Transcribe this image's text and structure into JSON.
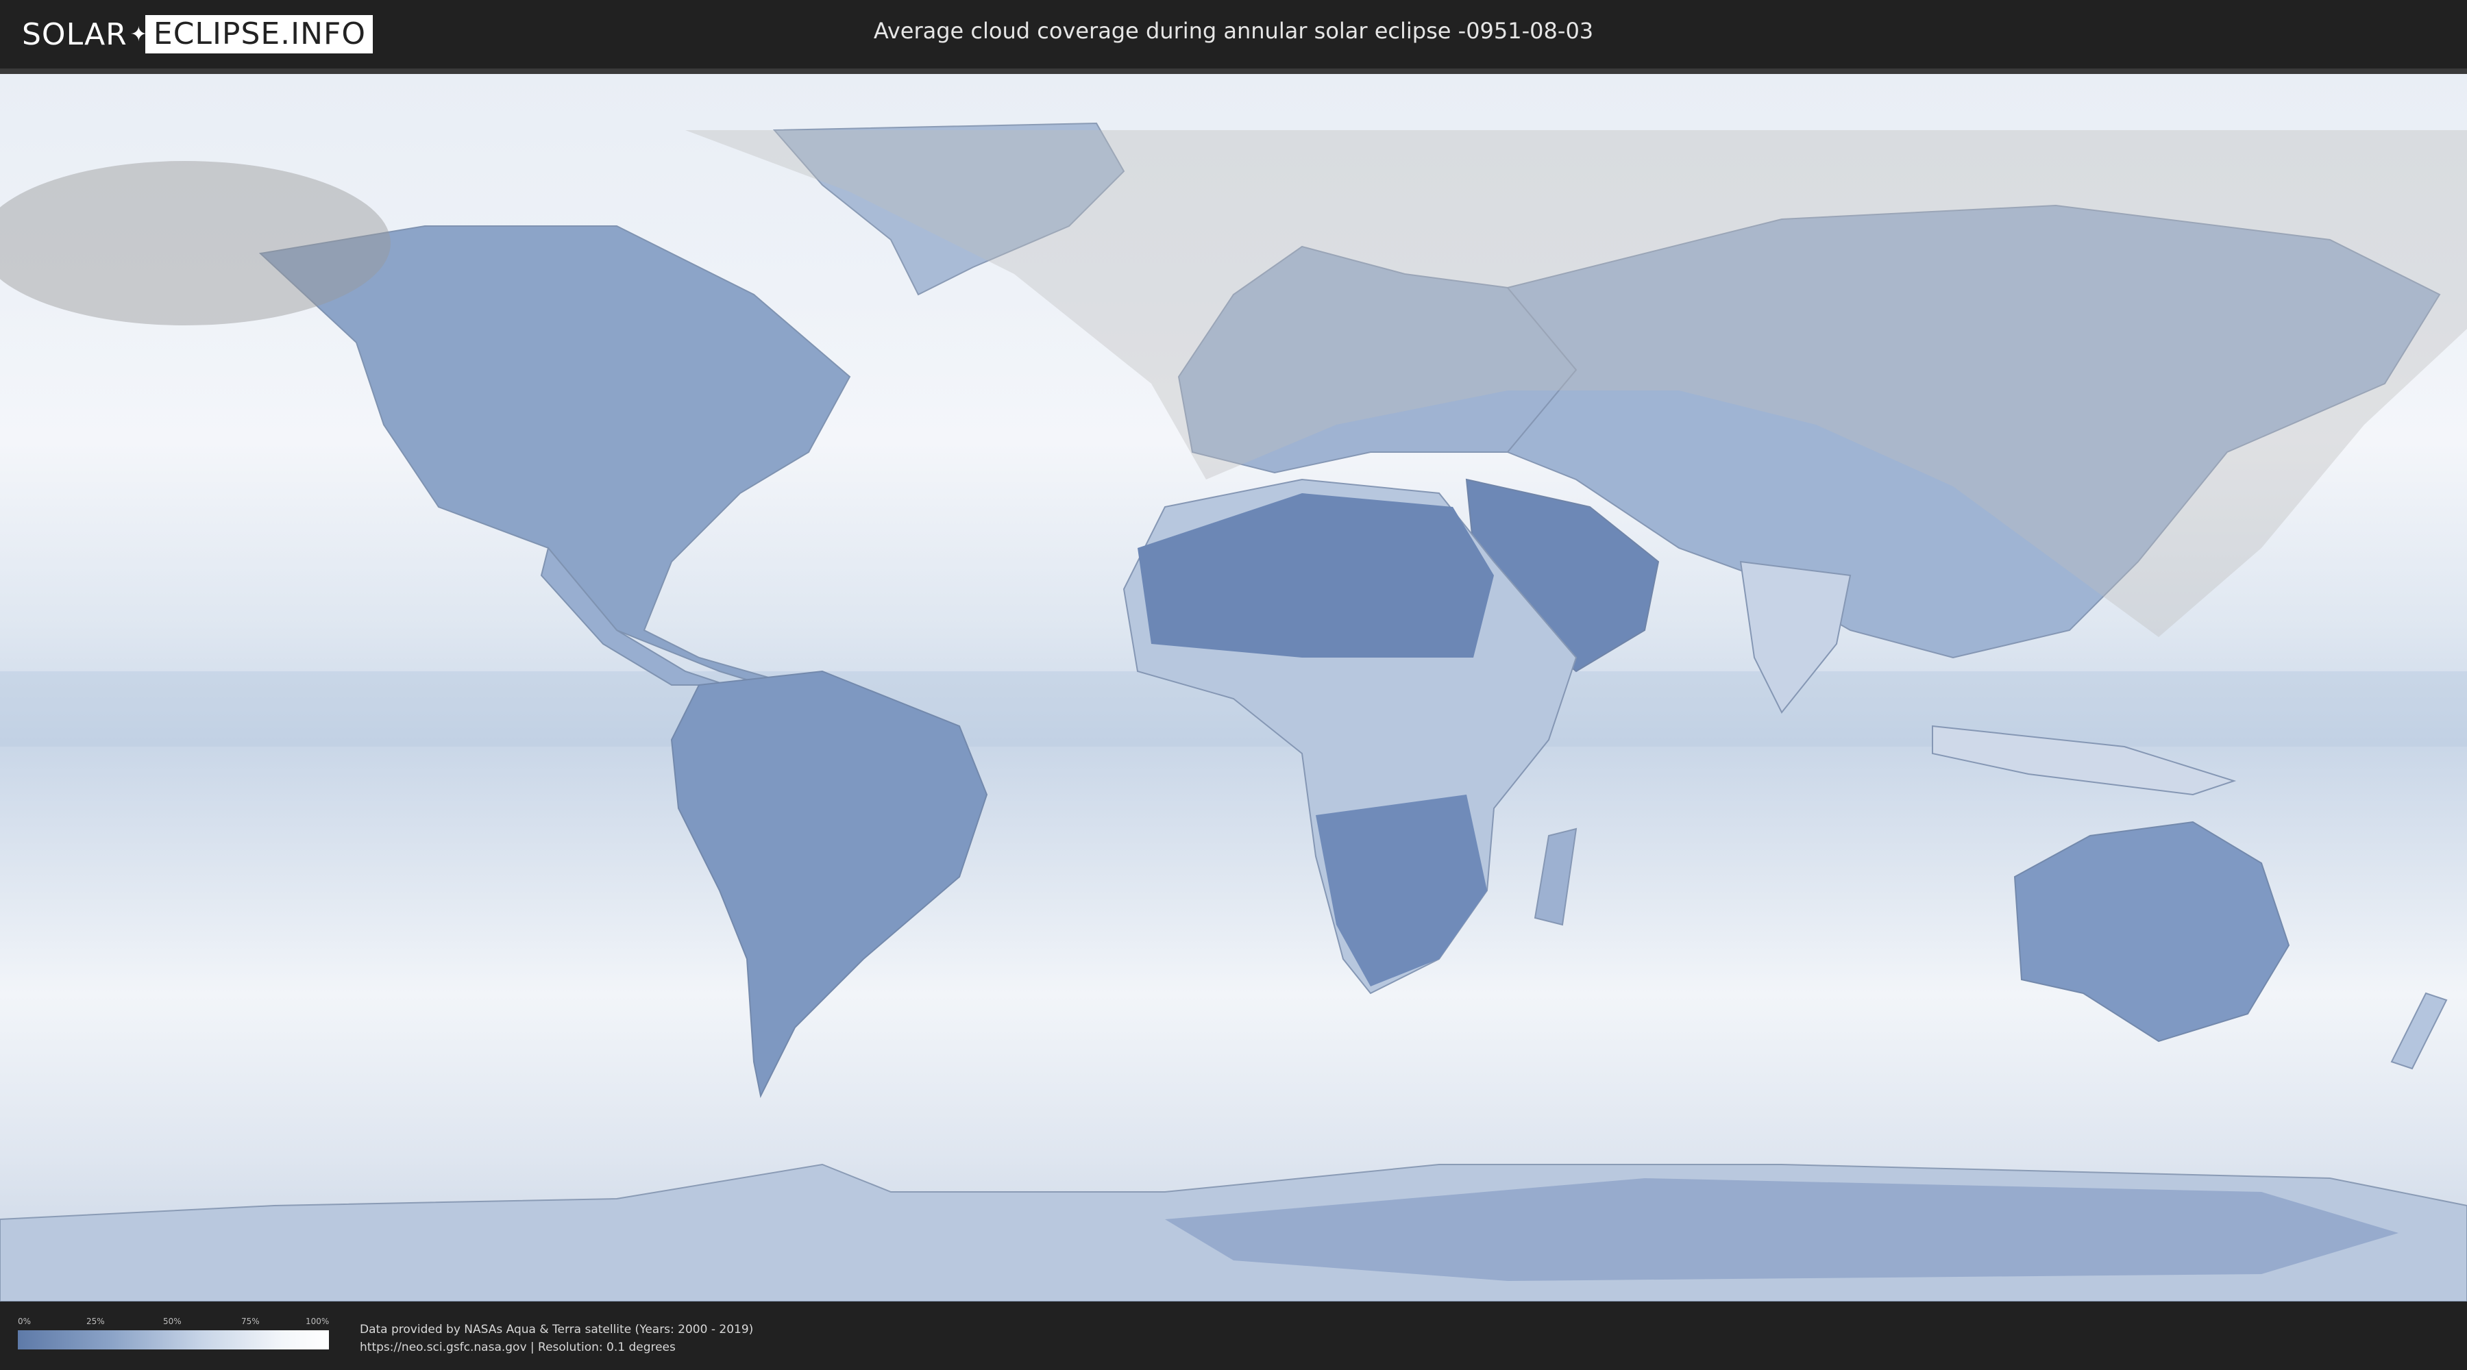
{
  "header": {
    "logo_left": "SOLAR",
    "logo_right": "ECLIPSE.INFO",
    "title": "Average cloud coverage during annular solar eclipse -0951-08-03"
  },
  "legend": {
    "ticks": [
      "0%",
      "25%",
      "50%",
      "75%",
      "100%"
    ],
    "colors": [
      "#5e7aa8",
      "#ffffff"
    ]
  },
  "credits": {
    "line1": "Data provided by NASAs Aqua & Terra satellite (Years: 2000 - 2019)",
    "line2": "https://neo.sci.gsfc.nasa.gov | Resolution: 0.1 degrees"
  },
  "colors": {
    "clear_sky": "#5e7aa8",
    "full_cloud": "#ffffff",
    "eclipse_visibility_overlay": "#bdbdbd"
  },
  "icons": [
    "logo-spark-icon"
  ]
}
